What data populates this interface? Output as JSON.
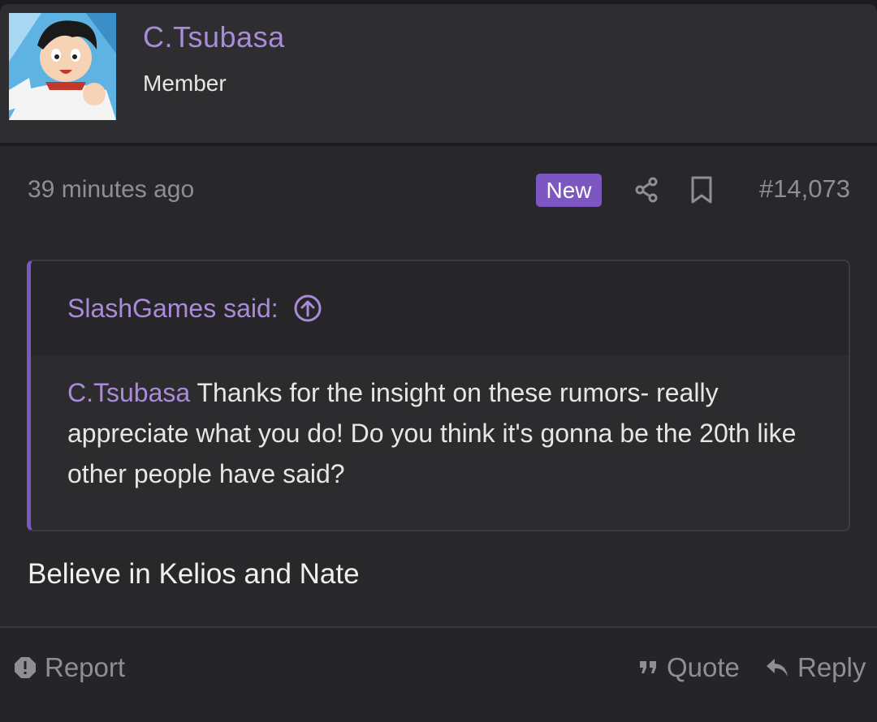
{
  "user": {
    "name": "C.Tsubasa",
    "title": "Member",
    "avatar_icon": "anime-avatar"
  },
  "post": {
    "time": "39 minutes ago",
    "badge": "New",
    "number": "#14,073",
    "text": "Believe in Kelios and Nate"
  },
  "quote": {
    "author_label": "SlashGames said:",
    "mention": "C.Tsubasa",
    "body": " Thanks for the insight on these rumors- really appreciate what you do! Do you think it's gonna be the 20th like other people have said?"
  },
  "actions": {
    "report": "Report",
    "quote": "Quote",
    "reply": "Reply"
  },
  "colors": {
    "accent": "#a98bd9",
    "badge": "#7c56c1",
    "background": "#28282a"
  }
}
